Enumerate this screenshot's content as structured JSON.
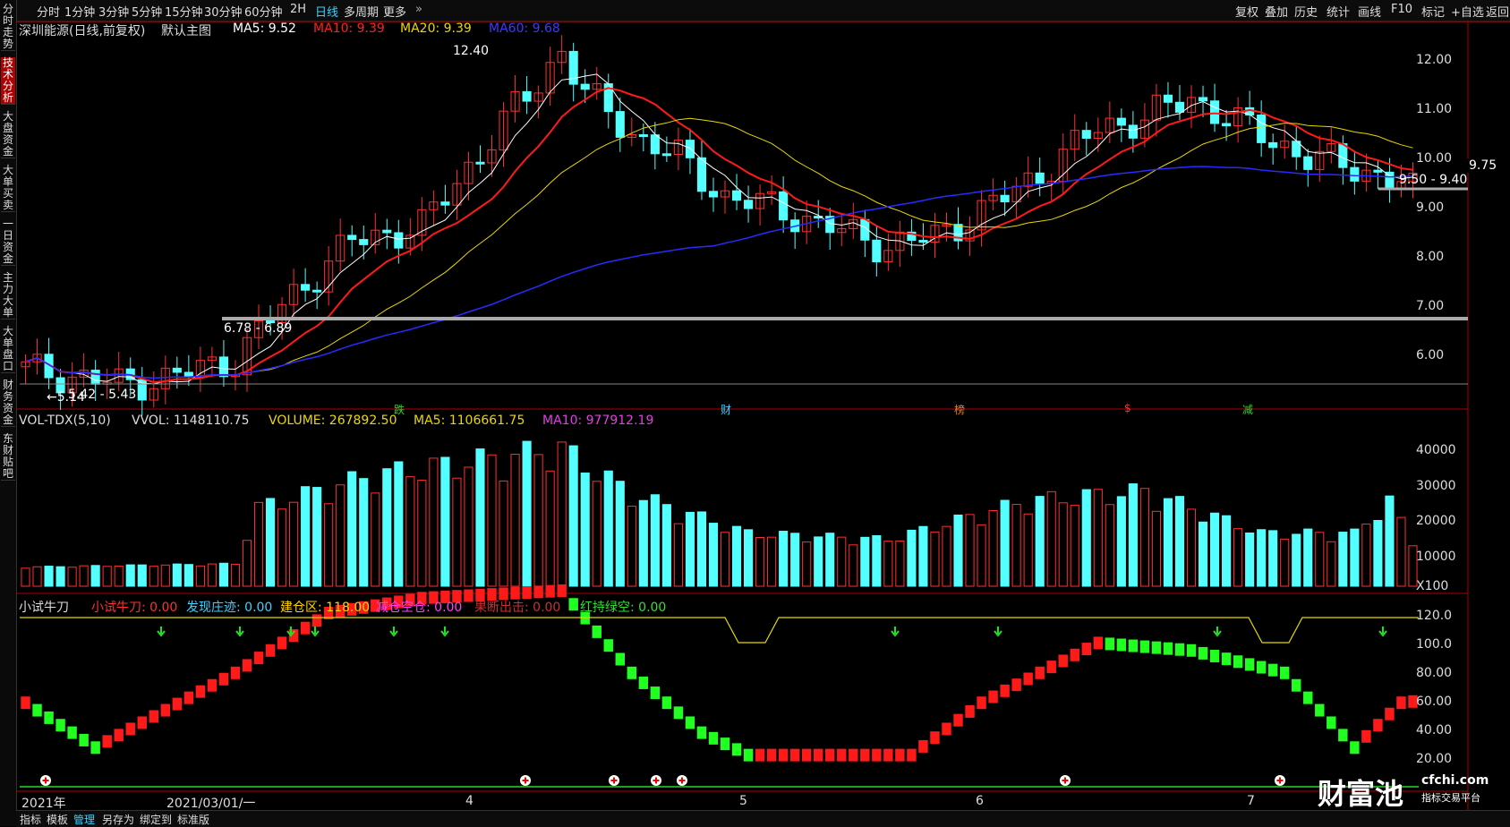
{
  "side_tabs": [
    {
      "label": "分时走势",
      "active": false
    },
    {
      "label": "技术分析",
      "active": true
    },
    {
      "label": "大盘资金",
      "active": false
    },
    {
      "label": "大单买卖",
      "active": false
    },
    {
      "label": "一日资金",
      "active": false
    },
    {
      "label": "主力大单",
      "active": false
    },
    {
      "label": "大单盘口",
      "active": false
    },
    {
      "label": "财务资金",
      "active": false
    },
    {
      "label": "东财贴吧",
      "active": false
    }
  ],
  "period_tabs": [
    "分时",
    "1分钟",
    "3分钟",
    "5分钟",
    "15分钟",
    "30分钟",
    "60分钟",
    "2H",
    "日线",
    "多周期",
    "更多"
  ],
  "active_period": "日线",
  "right_tabs": [
    "复权",
    "叠加",
    "历史",
    "统计",
    "画线",
    "F10",
    "标记",
    "+自选",
    "返回"
  ],
  "main_header": {
    "stock": "深圳能源(日线,前复权)",
    "template": "默认主图",
    "ma5": "MA5: 9.52",
    "ma10": "MA10: 9.39",
    "ma20": "MA20: 9.39",
    "ma60": "MA60: 9.68",
    "colors": {
      "ma5": "#ffffff",
      "ma10": "#ff2020",
      "ma20": "#e8d800",
      "ma60": "#2a2aff"
    }
  },
  "price_axis": [
    "12.00",
    "11.00",
    "10.00",
    "9.00",
    "8.00",
    "7.00",
    "6.00"
  ],
  "current_price": "9.75",
  "annotations": {
    "high": "12.40",
    "low_arrow": "←5.14",
    "range_low": "5.42 - 5.43",
    "range_mid": "6.78 - 6.89",
    "range_high": "9.50 - 9.40"
  },
  "event_marks": [
    "跌",
    "财",
    "榜",
    "$",
    "减"
  ],
  "vol_header": {
    "name": "VOL-TDX(5,10)",
    "vvol": "VVOL: 1148110.75",
    "volume": "VOLUME: 267892.50",
    "ma5": "MA5: 1106661.75",
    "ma10": "MA10: 977912.19"
  },
  "vol_axis": [
    "40000",
    "30000",
    "20000",
    "10000",
    "X100"
  ],
  "ind_header": {
    "name": "小试牛刀",
    "items": [
      {
        "label": "小试牛刀: 0.00",
        "color": "#ff3030"
      },
      {
        "label": "发现庄迹: 0.00",
        "color": "#3fd0ff"
      },
      {
        "label": "建仓区: 118.00",
        "color": "#ffd400"
      },
      {
        "label": "减仓空仓: 0.00",
        "color": "#ff40ff"
      },
      {
        "label": "果断出击: 0.00",
        "color": "#cc3030"
      },
      {
        "label": "红持绿空: 0.00",
        "color": "#30e030"
      }
    ]
  },
  "ind_axis": [
    "120.0",
    "100.0",
    "80.00",
    "60.00",
    "40.00",
    "20.00"
  ],
  "date_axis": [
    "2021年",
    "2021/03/01/一",
    "4",
    "5",
    "6",
    "7"
  ],
  "bottom_tabs": [
    "指标",
    "模板",
    "管理",
    "另存为",
    "绑定到",
    "标准版"
  ],
  "active_bottom": "管理",
  "watermark": {
    "brand": "财富池",
    "url": "cfchi.com",
    "tagline": "指标交易平台"
  }
}
